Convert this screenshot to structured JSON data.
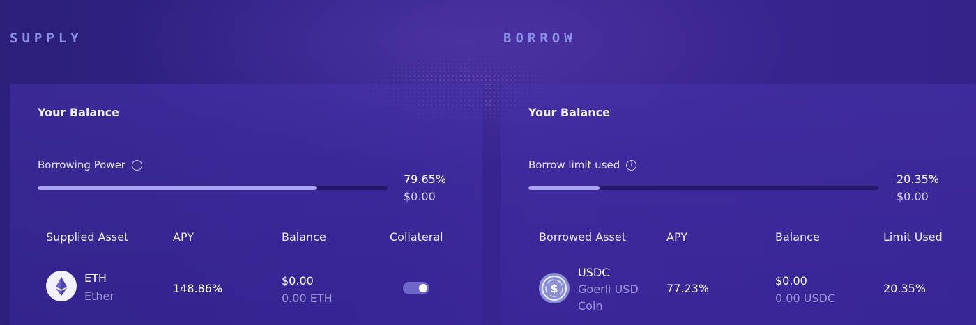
{
  "supply": {
    "title": "SUPPLY",
    "balance_title": "Your Balance",
    "power_label": "Borrowing Power",
    "power_fraction": 0.7965,
    "power_percent": "79.65%",
    "power_amount": "$0.00",
    "columns": [
      "Supplied Asset",
      "APY",
      "Balance",
      "Collateral"
    ],
    "rows": [
      {
        "symbol": "ETH",
        "name": "Ether",
        "icon": "ethereum-icon",
        "apy": "148.86%",
        "balance_usd": "$0.00",
        "balance_token": "0.00 ETH",
        "collateral_on": true
      }
    ]
  },
  "borrow": {
    "title": "BORROW",
    "balance_title": "Your Balance",
    "limit_label": "Borrow limit used",
    "limit_fraction": 0.2035,
    "limit_percent": "20.35%",
    "limit_amount": "$0.00",
    "columns": [
      "Borrowed Asset",
      "APY",
      "Balance",
      "Limit Used"
    ],
    "rows": [
      {
        "symbol": "USDC",
        "name_line1": "Goerli USD",
        "name_line2": "Coin",
        "icon": "usdc-icon",
        "apy": "77.23%",
        "balance_usd": "$0.00",
        "balance_token": "0.00 USDC",
        "limit_used": "20.35%"
      }
    ]
  },
  "colors": {
    "background": "#30208a",
    "section_title": "#8b8fe6",
    "progress_fill": "#a9a3f2",
    "progress_track": "#1e125a"
  }
}
